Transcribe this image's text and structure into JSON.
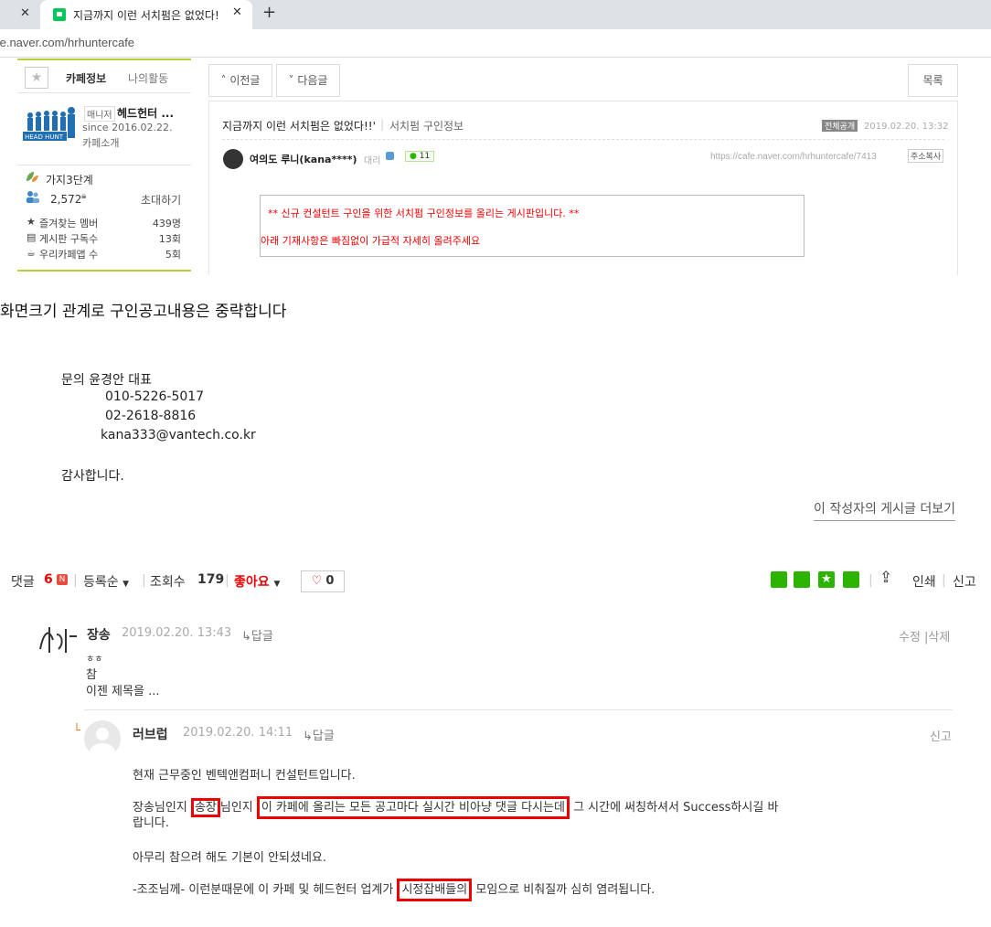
{
  "browser": {
    "tab_title": "지금까지 이런 서치펌은 없었다!",
    "url": "fe.naver.com/hrhuntercafe"
  },
  "cafe_sidebar": {
    "tab_info": "카페정보",
    "tab_activity": "나의활동",
    "manager_badge": "매니저",
    "manager_name": "헤드헌터 ...",
    "since": "since 2016.02.22.",
    "intro_link": "카페소개",
    "logo_text": "HEAD HUNT",
    "level": "가지3단계",
    "member_count": "2,572",
    "invite": "초대하기",
    "stats": [
      {
        "label": "즐겨찾는 멤버",
        "value": "439명"
      },
      {
        "label": "게시판 구독수",
        "value": "13회"
      },
      {
        "label": "우리카페앱 수",
        "value": "5회"
      }
    ]
  },
  "post": {
    "prev_button": "이전글",
    "next_button": "다음글",
    "list_button": "목록",
    "title": "지금까지 이런 서치펌은 없었다!!'",
    "category": "서치펌 구인정보",
    "public_badge": "전체공개",
    "date": "2019.02.20. 13:32",
    "author": "여의도 루니(kana****)",
    "rank": "대리",
    "comment_badge": "11",
    "url": "https://cafe.naver.com/hrhuntercafe/7413",
    "copy_url": "주소복사",
    "notice_line1": "**    신규 컨설턴트 구인을 위한 서치펌 구인정보를 올리는 게시판입니다.  **",
    "notice_line2": "아래 기재사항은 빠짐없이 가급적 자세히 올려주세요"
  },
  "body": {
    "omit_note": "화면크기 관계로 구인공고내용은 중략합니다",
    "contact_label": "문의 윤경안 대표",
    "phone1": "010-5226-5017",
    "phone2": "02-2618-8816",
    "email": "kana333@vantech.co.kr",
    "thanks": "감사합니다.",
    "more_link": "이 작성자의 게시글 더보기"
  },
  "comment_bar": {
    "comment_label": "댓글",
    "comment_count": "6",
    "sort": "등록순",
    "views_label": "조회수",
    "views": "179",
    "like_label": "좋아요",
    "like_count": "0",
    "print": "인쇄",
    "report": "신고"
  },
  "comments": [
    {
      "author": "장송",
      "date": "2019.02.20. 13:43",
      "reply": "답글",
      "actions": "수정 |삭제",
      "lines": [
        "ㅎㅎ",
        "참",
        "이젠 제목을 ..."
      ]
    },
    {
      "author": "러브럽",
      "date": "2019.02.20. 14:11",
      "reply": "답글",
      "actions": "신고",
      "line1": "현재 근무중인 벤텍앤컴퍼니 컨설턴트입니다.",
      "line2a": "장송님인지 ",
      "line2b": "송장",
      "line2c": "님인지 ",
      "line2d": "이 카페에 올리는 모든 공고마다 실시간  비아냥 댓글 다시는데",
      "line2e": " 그 시간에 써칭하셔서 Success하시길 바",
      "line3": "랍니다.",
      "line4": "아무리 참으려 해도 기본이 안되셨네요.",
      "line5a": "-조조님께- 이런분때문에 이 카페 및 헤드헌터 업계가 ",
      "line5b": "시정잡배들의",
      "line5c": " 모임으로 비춰질까 심히 염려됩니다."
    }
  ]
}
